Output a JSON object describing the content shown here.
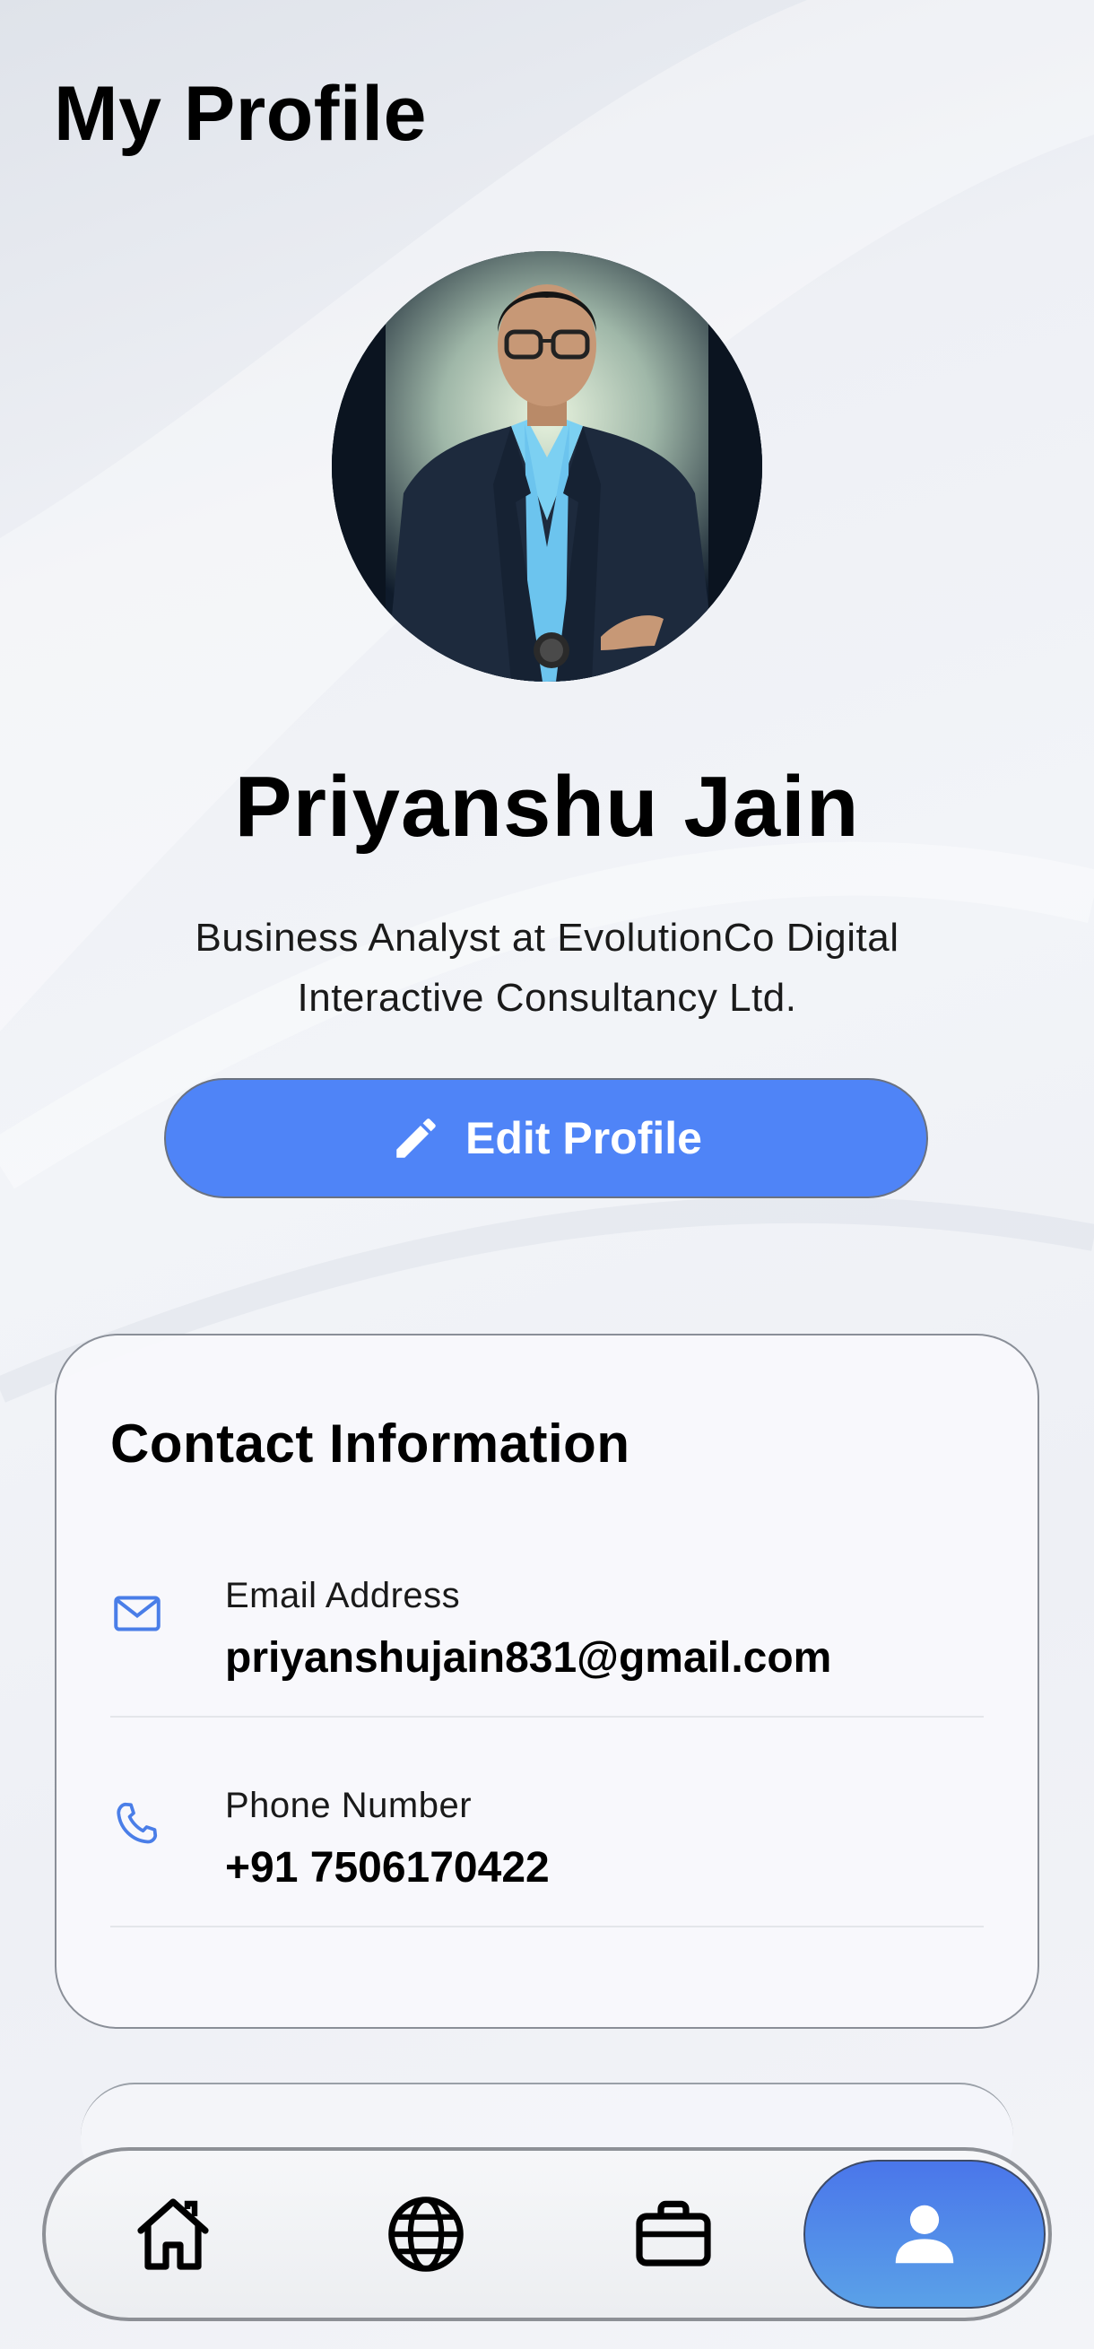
{
  "header": {
    "title": "My Profile"
  },
  "profile": {
    "name": "Priyanshu Jain",
    "bio": "Business Analyst at EvolutionCo Digital Interactive Consultancy Ltd.",
    "edit_label": "Edit Profile"
  },
  "contact": {
    "title": "Contact Information",
    "items": [
      {
        "icon": "mail-icon",
        "label": "Email Address",
        "value": "priyanshujain831@gmail.com"
      },
      {
        "icon": "phone-icon",
        "label": "Phone Number",
        "value": "+91 7506170422"
      }
    ]
  },
  "tabbar": {
    "tabs": [
      {
        "icon": "home-icon",
        "active": false
      },
      {
        "icon": "globe-icon",
        "active": false
      },
      {
        "icon": "briefcase-icon",
        "active": false
      },
      {
        "icon": "user-icon",
        "active": true
      }
    ]
  },
  "colors": {
    "accent": "#4f84f7",
    "active_tab_gradient_top": "#4a76ea",
    "active_tab_gradient_bottom": "#5aa1e8",
    "icon_blue": "#4a7ee8"
  }
}
